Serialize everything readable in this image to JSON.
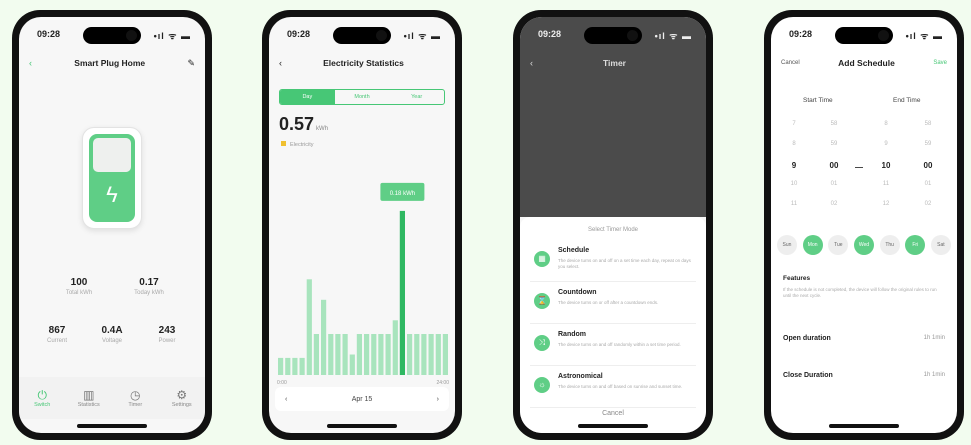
{
  "phones": [
    {
      "status": {
        "time": "09:28",
        "icons": "•ıl ᯤ ▬"
      },
      "header": {
        "title": "Smart Plug Home",
        "back_icon": "back-icon",
        "edit_icon": "edit-icon"
      },
      "stats_row1": [
        {
          "value": "100",
          "label": "Total kWh"
        },
        {
          "value": "0.17",
          "label": "Today kWh"
        }
      ],
      "stats_row2": [
        {
          "value": "867",
          "label": "Current"
        },
        {
          "value": "0.4A",
          "label": "Voltage"
        },
        {
          "value": "243",
          "label": "Power"
        }
      ],
      "tabs": [
        {
          "label": "Switch",
          "icon": "power-icon",
          "active": true
        },
        {
          "label": "Statistics",
          "icon": "bar-chart-icon",
          "active": false
        },
        {
          "label": "Timer",
          "icon": "clock-icon",
          "active": false
        },
        {
          "label": "Settings",
          "icon": "gear-icon",
          "active": false
        }
      ]
    },
    {
      "status": {
        "time": "09:28",
        "icons": "•ıl ᯤ ▬"
      },
      "header": {
        "title": "Electricity Statistics",
        "back_icon": "back-icon"
      },
      "segments": [
        "Day",
        "Month",
        "Year"
      ],
      "big_value": "0.57",
      "big_unit": "kWh",
      "legend_label": "Electricity",
      "tooltip": "0.18 kWh",
      "footer": {
        "prev": "‹",
        "label": "Apr 15",
        "next": "›"
      },
      "chart_data": {
        "type": "bar",
        "values": [
          0.05,
          0.05,
          0.05,
          0.05,
          0.28,
          0.12,
          0.22,
          0.12,
          0.12,
          0.12,
          0.06,
          0.12,
          0.12,
          0.12,
          0.12,
          0.12,
          0.16,
          0.48,
          0.12,
          0.12,
          0.12,
          0.12,
          0.12,
          0.12
        ],
        "highlight_index": 17,
        "x_tick_first": "0:00",
        "x_tick_last": "24:00",
        "color": "#5fce86",
        "ylim": [
          0,
          0.55
        ]
      }
    },
    {
      "status": {
        "time": "09:28",
        "icons": "•ıl ᯤ ▬"
      },
      "header": {
        "title": "Timer",
        "back_icon": "back-icon"
      },
      "sheet_title": "Select Timer Mode",
      "options": [
        {
          "title": "Schedule",
          "desc": "The device turns on and off on a set time each day, repeat on days you select.",
          "icon": "calendar-icon"
        },
        {
          "title": "Countdown",
          "desc": "The device turns on or off after a countdown ends.",
          "icon": "hourglass-icon"
        },
        {
          "title": "Random",
          "desc": "The device turns on and off randomly within a set time period.",
          "icon": "shuffle-icon"
        },
        {
          "title": "Astronomical",
          "desc": "The device turns on and off based on sunrise and sunset time.",
          "icon": "sun-icon"
        }
      ],
      "cancel": "Cancel"
    },
    {
      "status": {
        "time": "09:28",
        "icons": "•ıl ᯤ ▬"
      },
      "header": {
        "cancel": "Cancel",
        "title": "Add Schedule",
        "save": "Save"
      },
      "start_label": "Start Time",
      "end_label": "End Time",
      "start_hours": [
        "7",
        "8",
        "9",
        "10",
        "11"
      ],
      "start_minutes": [
        "58",
        "59",
        "00",
        "01",
        "02"
      ],
      "end_hours": [
        "8",
        "9",
        "10",
        "11",
        "12"
      ],
      "end_minutes": [
        "58",
        "59",
        "00",
        "01",
        "02"
      ],
      "dash": "—",
      "days": [
        {
          "label": "Sun",
          "on": false
        },
        {
          "label": "Mon",
          "on": true
        },
        {
          "label": "Tue",
          "on": false
        },
        {
          "label": "Wed",
          "on": true
        },
        {
          "label": "Thu",
          "on": false
        },
        {
          "label": "Fri",
          "on": true
        },
        {
          "label": "Sat",
          "on": false
        }
      ],
      "note_title": "Features",
      "note_text": "If the schedule is not completed, the device will follow the original rules to run until the next cycle.",
      "rows": [
        {
          "label": "Open duration",
          "value": "1h 1min"
        },
        {
          "label": "Close Duration",
          "value": "1h 1min"
        }
      ]
    }
  ]
}
